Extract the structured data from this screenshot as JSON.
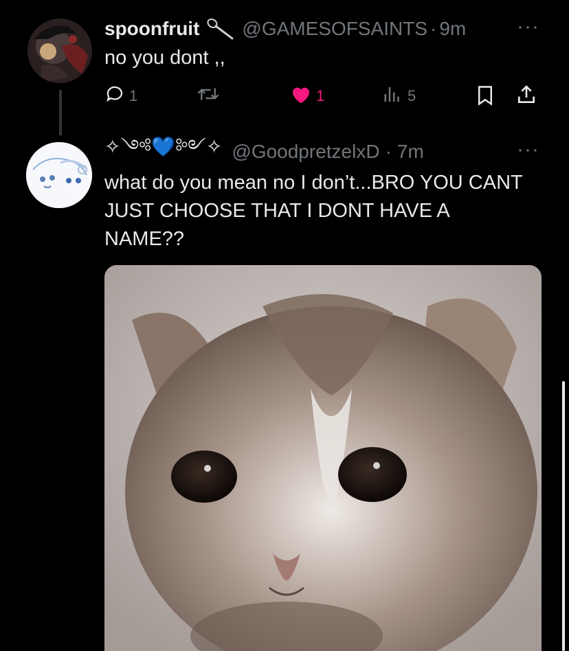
{
  "tweet1": {
    "display_name": "spoonfruit",
    "name_icon": "spoon-icon",
    "handle": "@GAMESOFSAINTS",
    "separator": "·",
    "time": "9m",
    "text": "no you dont ,,",
    "actions": {
      "reply_count": "1",
      "retweet_count": "",
      "like_count": "1",
      "views_count": "5"
    },
    "colors": {
      "like": "#f91880"
    }
  },
  "tweet2": {
    "display_name": "✧༺💙༻✧",
    "handle": "@GoodpretzelxD",
    "separator": "·",
    "time": "7m",
    "text": "what do you mean no I don’t...BRO YOU CANT JUST CHOOSE THAT I DONT HAVE A NAME??",
    "media": "crying kitten photo"
  },
  "colors": {
    "background": "#000000",
    "text": "#e7e9ea",
    "muted": "#71767b",
    "like": "#f91880"
  }
}
